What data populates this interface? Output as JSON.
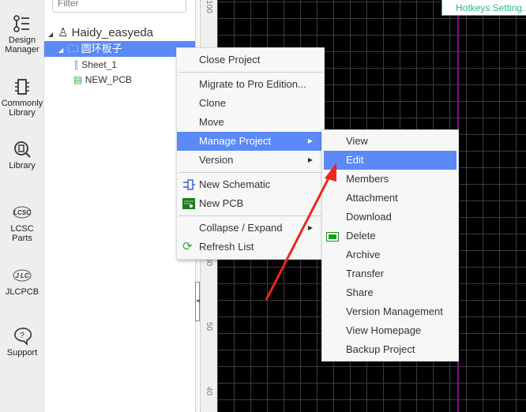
{
  "sidebar": {
    "items": [
      {
        "label": "Design Manager",
        "icon": "design-manager-icon"
      },
      {
        "label": "Commonly Library",
        "icon": "chip-icon"
      },
      {
        "label": "Library",
        "icon": "library-search-icon"
      },
      {
        "label": "LCSC Parts",
        "icon": "lcsc-logo-icon"
      },
      {
        "label": "JLCPCB",
        "icon": "jlc-logo-icon"
      },
      {
        "label": "Support",
        "icon": "support-question-icon"
      }
    ]
  },
  "panel": {
    "filter_placeholder": "Filter",
    "tree": {
      "user": "Haidy_easyeda",
      "project": "圆环板子",
      "children": [
        "Sheet_1",
        "NEW_PCB"
      ]
    }
  },
  "ruler": {
    "labels": [
      "100",
      "60",
      "50",
      "40"
    ]
  },
  "toolbar": {
    "hotkeys": "Hotkeys Setting..."
  },
  "context_menu": {
    "items": [
      "Close Project",
      "Migrate to Pro Edition...",
      "Clone",
      "Move",
      "Manage Project",
      "Version",
      "New Schematic",
      "New PCB",
      "Collapse / Expand",
      "Refresh List"
    ]
  },
  "submenu": {
    "items": [
      "View",
      "Edit",
      "Members",
      "Attachment",
      "Download",
      "Delete",
      "Archive",
      "Transfer",
      "Share",
      "Version Management",
      "View Homepage",
      "Backup Project"
    ]
  },
  "colors": {
    "highlight": "#5b8af7",
    "annotation_arrow": "#f0251d",
    "hotkeys": "#2eb88a"
  }
}
